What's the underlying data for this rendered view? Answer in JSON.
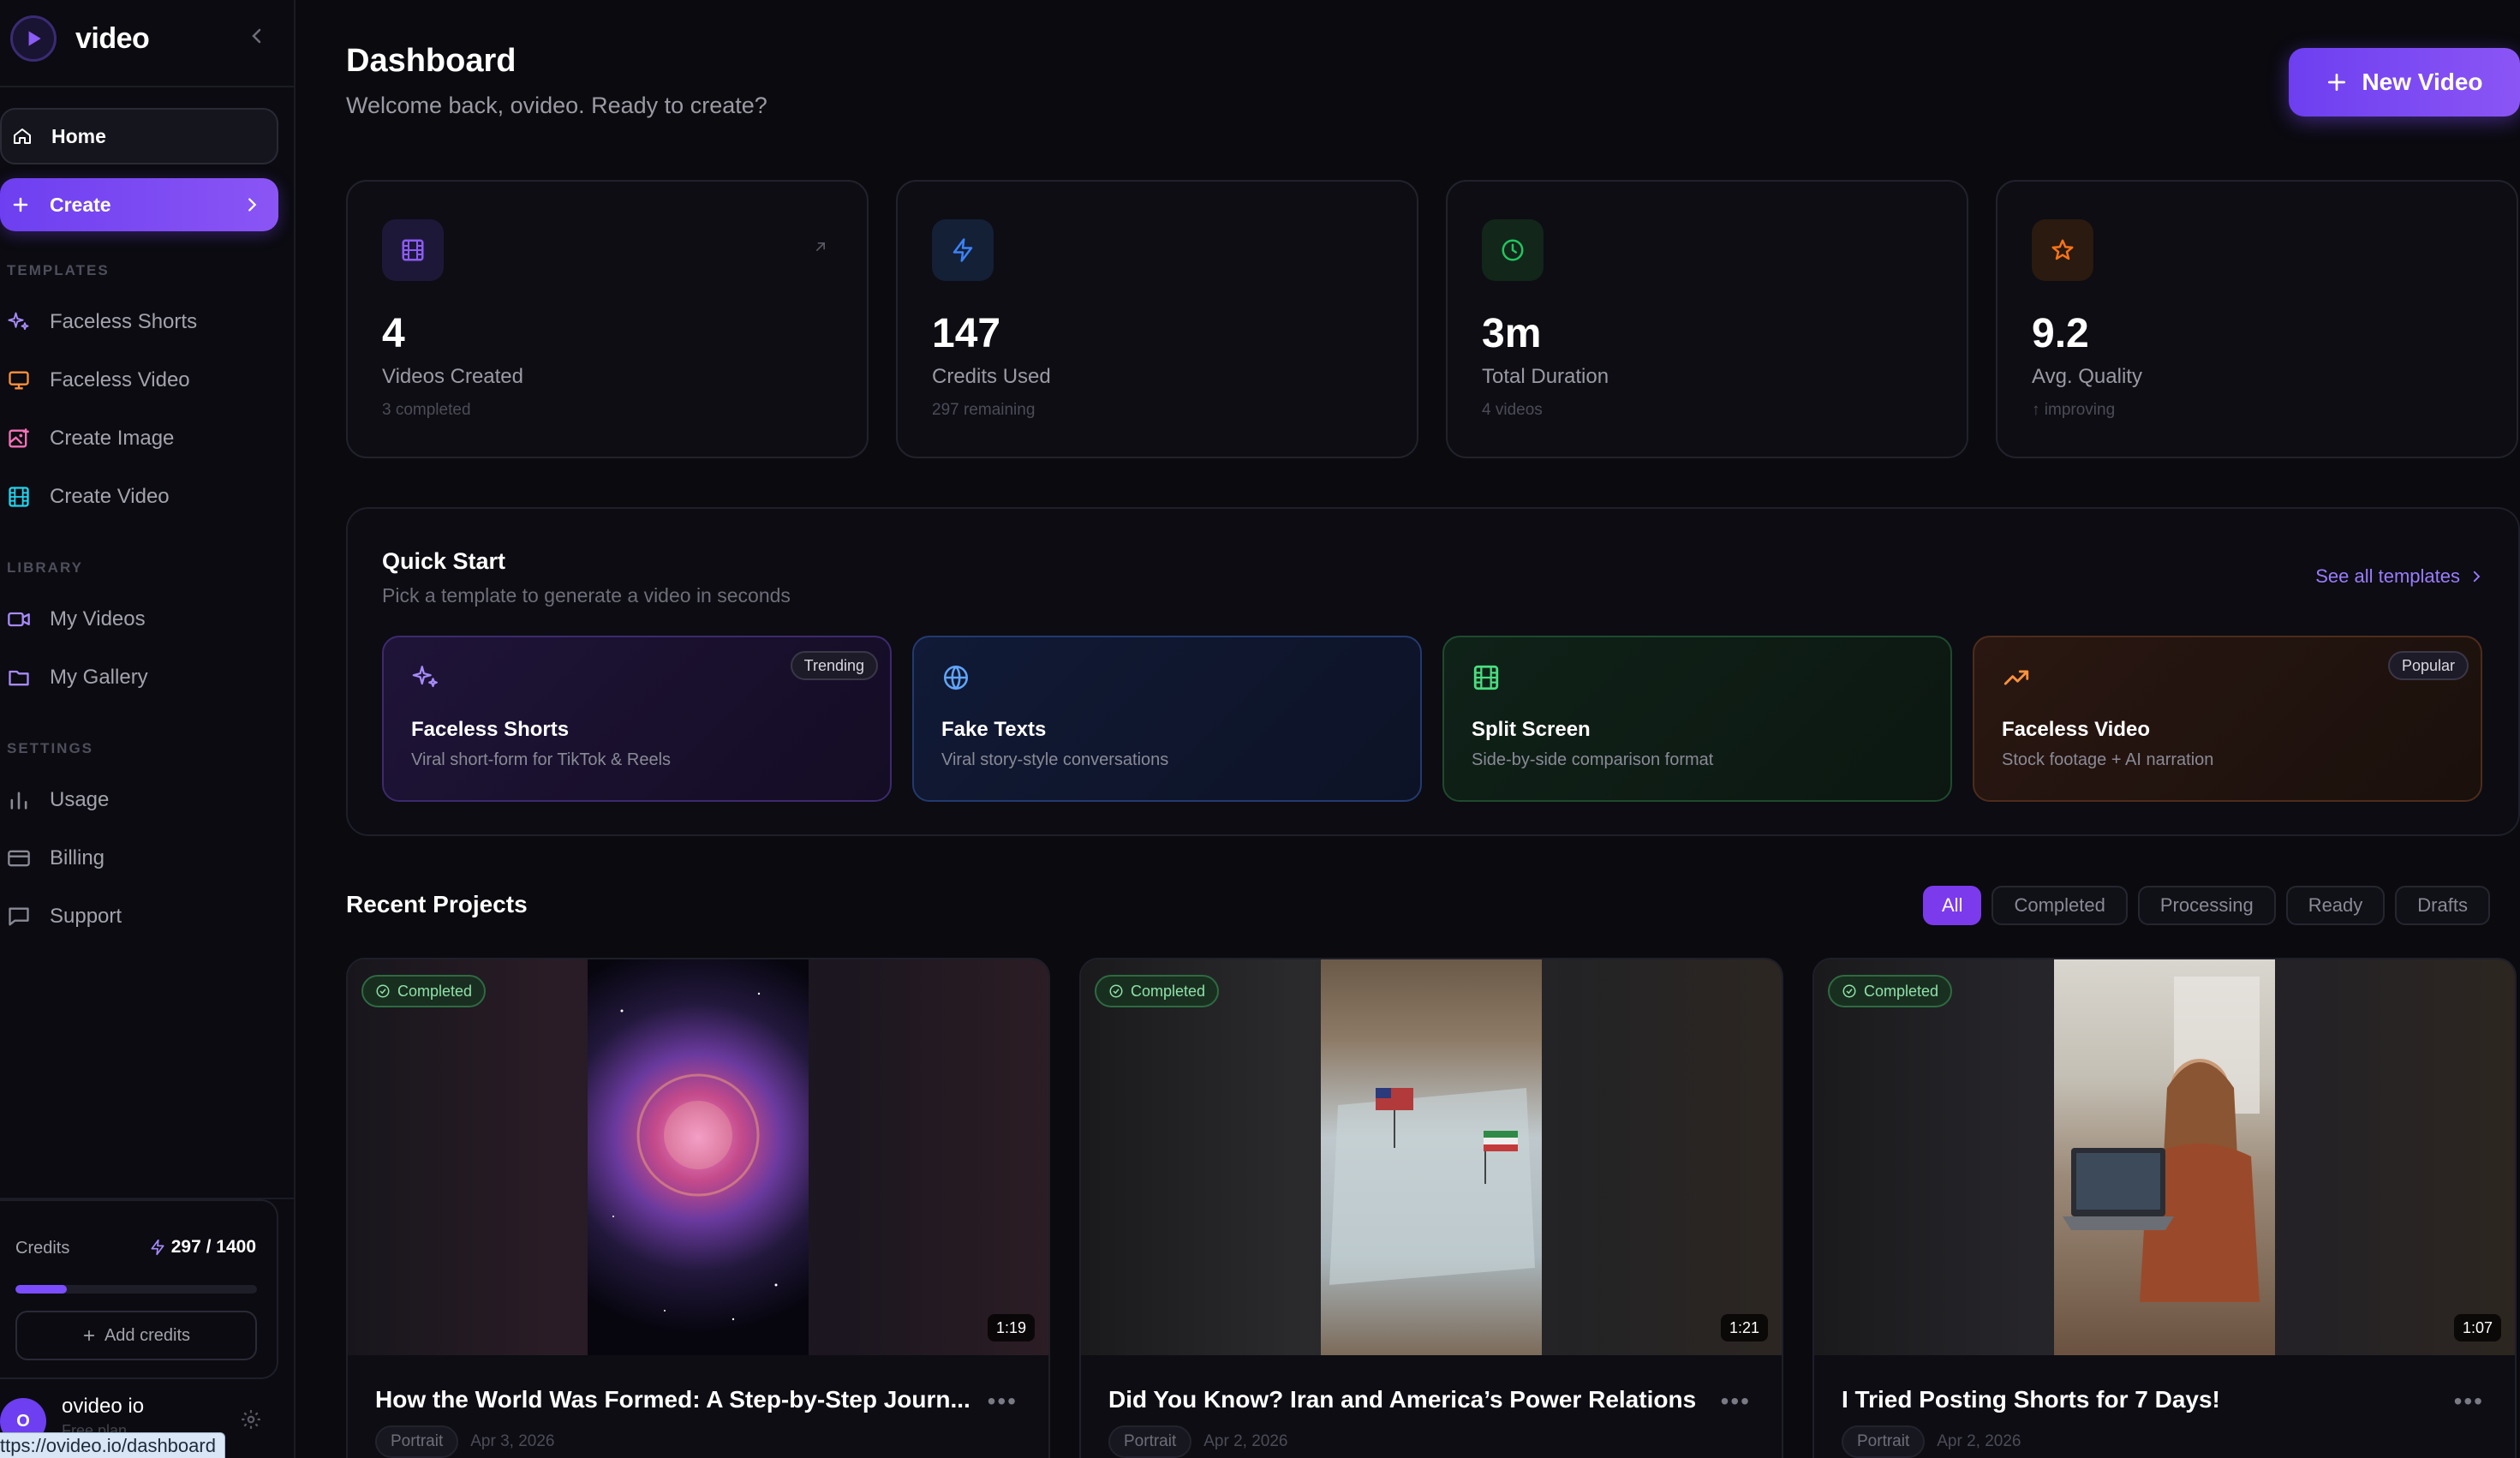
{
  "app": {
    "name": "video"
  },
  "sidebar": {
    "home_label": "Home",
    "create_label": "Create",
    "sections": {
      "templates": "TEMPLATES",
      "library": "LIBRARY",
      "settings": "SETTINGS"
    },
    "templates": [
      {
        "label": "Faceless Shorts",
        "icon": "sparkles-icon",
        "color": "#a78bfa"
      },
      {
        "label": "Faceless Video",
        "icon": "monitor-icon",
        "color": "#fb923c"
      },
      {
        "label": "Create Image",
        "icon": "image-plus-icon",
        "color": "#f472b6"
      },
      {
        "label": "Create Video",
        "icon": "film-icon",
        "color": "#22d3ee"
      }
    ],
    "library": [
      {
        "label": "My Videos",
        "icon": "video-icon"
      },
      {
        "label": "My Gallery",
        "icon": "folder-icon"
      }
    ],
    "settings": [
      {
        "label": "Usage",
        "icon": "bar-chart-icon"
      },
      {
        "label": "Billing",
        "icon": "credit-card-icon"
      },
      {
        "label": "Support",
        "icon": "message-icon"
      }
    ],
    "credits": {
      "label": "Credits",
      "value": "297 / 1400",
      "used_fraction": 0.212,
      "add_label": "Add credits"
    },
    "user": {
      "initial": "O",
      "name": "ovideo io",
      "sub": "Free plan"
    },
    "status_url": "ttps://ovideo.io/dashboard"
  },
  "header": {
    "title": "Dashboard",
    "subtitle": "Welcome back, ovideo. Ready to create?",
    "new_video_label": "New Video"
  },
  "stats": [
    {
      "value": "4",
      "label": "Videos Created",
      "sub": "3 completed",
      "icon": "film-icon",
      "color": "#8b5cf6"
    },
    {
      "value": "147",
      "label": "Credits Used",
      "sub": "297 remaining",
      "icon": "bolt-icon",
      "color": "#3b82f6"
    },
    {
      "value": "3m",
      "label": "Total Duration",
      "sub": "4 videos",
      "icon": "clock-icon",
      "color": "#22c55e"
    },
    {
      "value": "9.2",
      "label": "Avg. Quality",
      "sub": "↑ improving",
      "icon": "star-icon",
      "color": "#f97316"
    }
  ],
  "quick_start": {
    "title": "Quick Start",
    "subtitle": "Pick a template to generate a video in seconds",
    "see_all": "See all templates",
    "templates": [
      {
        "title": "Faceless Shorts",
        "desc": "Viral short-form for TikTok & Reels",
        "badge": "Trending",
        "icon": "sparkles-icon"
      },
      {
        "title": "Fake Texts",
        "desc": "Viral story-style conversations",
        "badge": "",
        "icon": "globe-icon"
      },
      {
        "title": "Split Screen",
        "desc": "Side-by-side comparison format",
        "badge": "",
        "icon": "film-icon"
      },
      {
        "title": "Faceless Video",
        "desc": "Stock footage + AI narration",
        "badge": "Popular",
        "icon": "trending-up-icon"
      }
    ]
  },
  "recent": {
    "title": "Recent Projects",
    "filters": [
      "All",
      "Completed",
      "Processing",
      "Ready",
      "Drafts"
    ],
    "active_filter": "All",
    "projects": [
      {
        "title": "How the World Was Formed: A Step-by-Step Journ...",
        "status": "Completed",
        "duration": "1:19",
        "tag": "Portrait",
        "date": "Apr 3, 2026"
      },
      {
        "title": "Did You Know? Iran and America’s Power Relations",
        "status": "Completed",
        "duration": "1:21",
        "tag": "Portrait",
        "date": "Apr 2, 2026"
      },
      {
        "title": "I Tried Posting Shorts for 7 Days!",
        "status": "Completed",
        "duration": "1:07",
        "tag": "Portrait",
        "date": "Apr 2, 2026"
      }
    ]
  }
}
